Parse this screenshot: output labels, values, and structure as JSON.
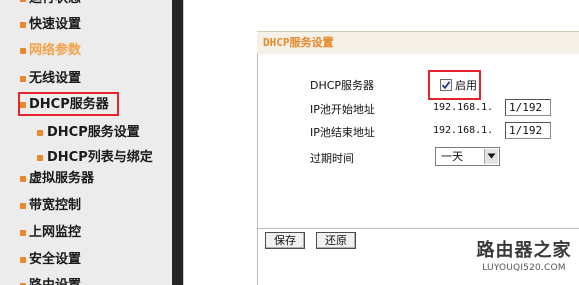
{
  "sidebar": {
    "items": [
      {
        "label": "运行状态",
        "level": "top",
        "state": "cutoff"
      },
      {
        "label": "快速设置",
        "level": "top"
      },
      {
        "label": "网络参数",
        "level": "top",
        "state": "active"
      },
      {
        "label": "无线设置",
        "level": "top"
      },
      {
        "label": "DHCP服务器",
        "level": "top",
        "state": "selected"
      },
      {
        "label": "DHCP服务设置",
        "level": "sub"
      },
      {
        "label": "DHCP列表与绑定",
        "level": "sub"
      },
      {
        "label": "虚拟服务器",
        "level": "top"
      },
      {
        "label": "带宽控制",
        "level": "top"
      },
      {
        "label": "上网监控",
        "level": "top"
      },
      {
        "label": "安全设置",
        "level": "top"
      },
      {
        "label": "路由设置",
        "level": "top",
        "state": "cutoff"
      }
    ]
  },
  "panel": {
    "title": "DHCP服务设置",
    "dhcp_server_label": "DHCP服务器",
    "dhcp_enable_label": "启用",
    "dhcp_enabled": true,
    "ip_start_label": "IP池开始地址",
    "ip_start_prefix": "192.168.1.",
    "ip_start_value": "1/192",
    "ip_end_label": "IP池结束地址",
    "ip_end_prefix": "192.168.1.",
    "ip_end_value": "1/192",
    "lease_label": "过期时间",
    "lease_value": "一天"
  },
  "buttons": {
    "save": "保存",
    "reset": "还原"
  },
  "watermark": {
    "brand": "路由器之家",
    "url": "LUYOUQI520.COM"
  },
  "colors": {
    "accent_orange": "#e9882a",
    "highlight_red": "#e4252c",
    "sidebar_bg": "#ececec"
  }
}
